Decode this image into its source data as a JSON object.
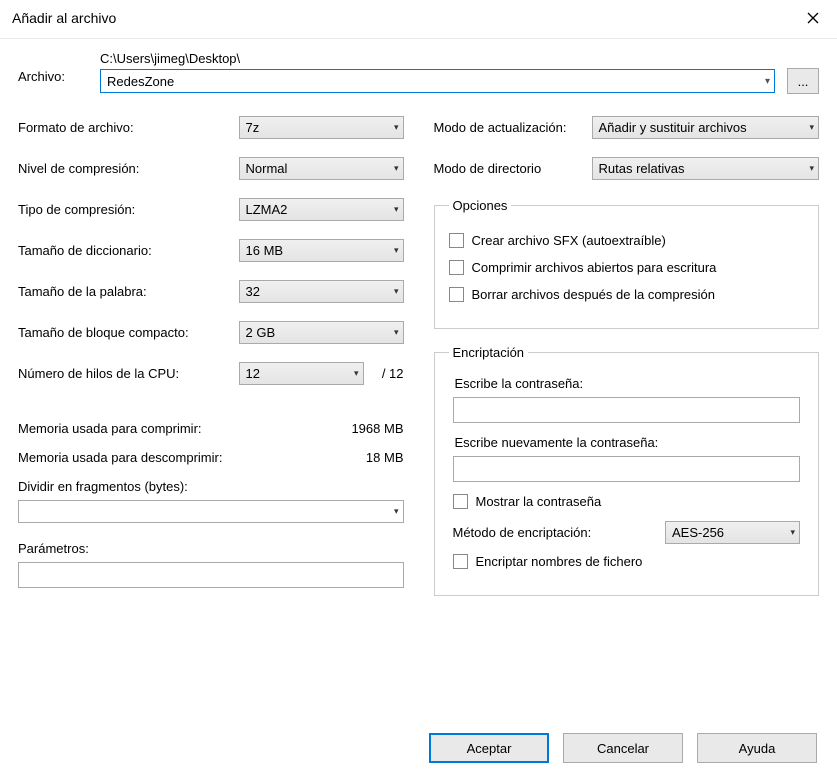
{
  "title": "Añadir al archivo",
  "archive": {
    "label": "Archivo:",
    "path": "C:\\Users\\jimeg\\Desktop\\",
    "value": "RedesZone",
    "browse": "..."
  },
  "left": {
    "format": {
      "label": "Formato de archivo:",
      "value": "7z"
    },
    "level": {
      "label": "Nivel de compresión:",
      "value": "Normal"
    },
    "ctype": {
      "label": "Tipo de compresión:",
      "value": "LZMA2"
    },
    "dict": {
      "label": "Tamaño de diccionario:",
      "value": "16 MB"
    },
    "word": {
      "label": "Tamaño de la palabra:",
      "value": "32"
    },
    "block": {
      "label": "Tamaño de bloque compacto:",
      "value": "2 GB"
    },
    "threads": {
      "label": "Número de hilos de la CPU:",
      "value": "12",
      "max": "/ 12"
    },
    "mem_compress": {
      "label": "Memoria usada para comprimir:",
      "value": "1968 MB"
    },
    "mem_decompress": {
      "label": "Memoria usada para descomprimir:",
      "value": "18 MB"
    },
    "split": {
      "label": "Dividir en fragmentos (bytes):"
    },
    "params": {
      "label": "Parámetros:"
    }
  },
  "right": {
    "update_mode": {
      "label": "Modo de actualización:",
      "value": "Añadir y sustituir archivos"
    },
    "dir_mode": {
      "label": "Modo de directorio",
      "value": "Rutas relativas"
    },
    "options": {
      "legend": "Opciones",
      "sfx": "Crear archivo SFX (autoextraíble)",
      "open_files": "Comprimir archivos abiertos para escritura",
      "delete_after": "Borrar archivos después de la compresión"
    },
    "encryption": {
      "legend": "Encriptación",
      "pw1": "Escribe la contraseña:",
      "pw2": "Escribe nuevamente la contraseña:",
      "show": "Mostrar la contraseña",
      "method_label": "Método de encriptación:",
      "method_value": "AES-256",
      "encrypt_names": "Encriptar nombres de fichero"
    }
  },
  "buttons": {
    "ok": "Aceptar",
    "cancel": "Cancelar",
    "help": "Ayuda"
  }
}
